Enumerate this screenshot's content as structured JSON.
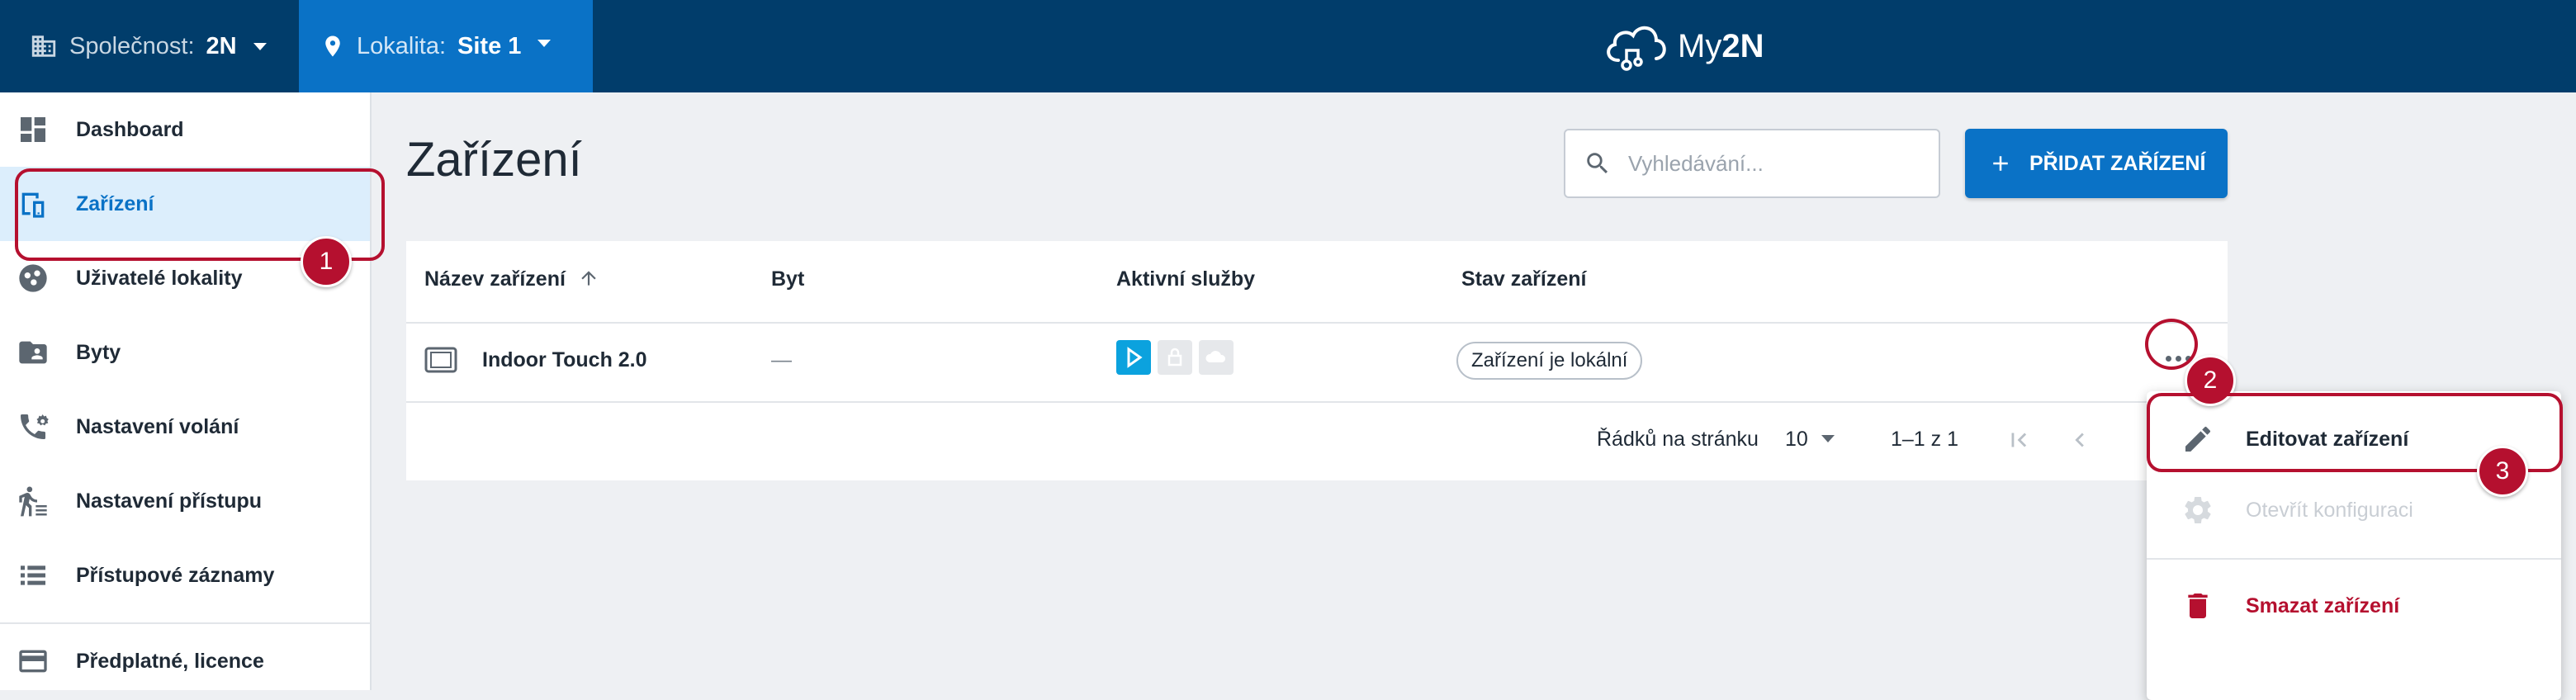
{
  "topbar": {
    "company_label": "Společnost:",
    "company_value": "2N",
    "location_label": "Lokalita:",
    "location_value": "Site 1",
    "logo_text_light": "My",
    "logo_text_bold": "2N"
  },
  "sidebar": {
    "items": [
      {
        "label": "Dashboard",
        "icon": "dashboard-icon"
      },
      {
        "label": "Zařízení",
        "icon": "device-icon"
      },
      {
        "label": "Uživatelé lokality",
        "icon": "users-icon"
      },
      {
        "label": "Byty",
        "icon": "apartment-folder-icon"
      },
      {
        "label": "Nastavení volání",
        "icon": "phone-settings-icon"
      },
      {
        "label": "Nastavení přístupu",
        "icon": "walking-person-icon"
      },
      {
        "label": "Přístupové záznamy",
        "icon": "list-icon"
      },
      {
        "label": "Předplatné, licence",
        "icon": "card-icon"
      }
    ]
  },
  "main": {
    "title": "Zařízení",
    "search_placeholder": "Vyhledávání...",
    "add_button": "PŘIDAT ZAŘÍZENÍ"
  },
  "table": {
    "columns": [
      "Název zařízení",
      "Byt",
      "Aktivní služby",
      "Stav zařízení"
    ],
    "rows": [
      {
        "name": "Indoor Touch 2.0",
        "apartment": "—",
        "status": "Zařízení je lokální"
      }
    ]
  },
  "pagination": {
    "rows_label": "Řádků na stránku",
    "rows_value": "10",
    "range": "1–1 z 1"
  },
  "context_menu": {
    "items": [
      {
        "label": "Editovat zařízení",
        "enabled": true
      },
      {
        "label": "Otevřít konfiguraci",
        "enabled": false
      },
      {
        "label": "Smazat zařízení",
        "enabled": true,
        "danger": true
      }
    ]
  },
  "annotations": {
    "badges": [
      "1",
      "2",
      "3"
    ]
  },
  "colors": {
    "topbar": "#013d6b",
    "accent": "#0a72c6",
    "highlight": "#b5102f"
  }
}
